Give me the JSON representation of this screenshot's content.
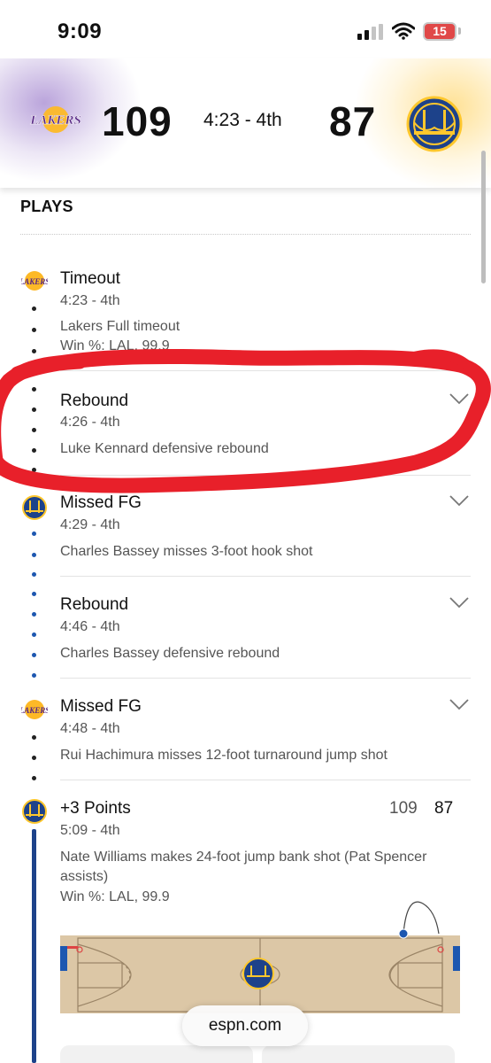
{
  "status_bar": {
    "time": "9:09",
    "battery": "15",
    "battery_color": "#e04848",
    "icons": [
      "signal-icon",
      "wifi-icon",
      "battery-icon"
    ]
  },
  "scoreboard": {
    "home_team_logo": "lakers-logo",
    "home_score": "109",
    "clock": "4:23 - 4th",
    "away_score": "87",
    "away_team_logo": "warriors-logo",
    "home_color": "#552583",
    "away_color": "#1d428a"
  },
  "section_title": "PLAYS",
  "plays": [
    {
      "team": "LAL",
      "title": "Timeout",
      "time": "4:23 - 4th",
      "description": "Lakers Full timeout",
      "extra": "Win %: LAL, 99.9",
      "expandable": false
    },
    {
      "team": "LAL",
      "title": "Rebound",
      "time": "4:26 - 4th",
      "description": "Luke Kennard defensive rebound",
      "expandable": true
    },
    {
      "team": "GSW",
      "title": "Missed FG",
      "time": "4:29 - 4th",
      "description": "Charles Bassey misses 3-foot hook shot",
      "expandable": true
    },
    {
      "team": "GSW",
      "title": "Rebound",
      "time": "4:46 - 4th",
      "description": "Charles Bassey defensive rebound",
      "expandable": true
    },
    {
      "team": "LAL",
      "title": "Missed FG",
      "time": "4:48 - 4th",
      "description": "Rui Hachimura misses 12-foot turnaround jump shot",
      "expandable": true
    },
    {
      "team": "GSW",
      "title": "+3 Points",
      "time": "5:09 - 4th",
      "description": "Nate Williams makes 24-foot jump bank shot (Pat Spencer assists)",
      "extra": "Win %: LAL, 99.9",
      "score_home": "109",
      "score_away": "87",
      "expandable": false
    }
  ],
  "court": {
    "center_logo": "warriors-logo",
    "shot_marker": "made-shot-marker"
  },
  "annotation": {
    "type": "red-hand-drawn-circle",
    "color": "#e8202a"
  },
  "browser": {
    "url": "espn.com"
  }
}
